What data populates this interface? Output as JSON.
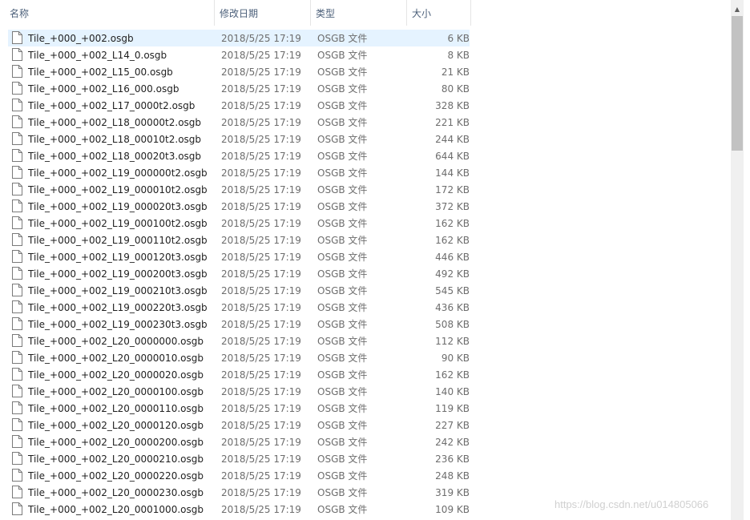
{
  "columns": {
    "name": "名称",
    "date": "修改日期",
    "type": "类型",
    "size": "大小"
  },
  "sort_indicator": "^",
  "files": [
    {
      "name": "Tile_+000_+002.osgb",
      "date": "2018/5/25 17:19",
      "type": "OSGB 文件",
      "size": "6 KB",
      "selected": true
    },
    {
      "name": "Tile_+000_+002_L14_0.osgb",
      "date": "2018/5/25 17:19",
      "type": "OSGB 文件",
      "size": "8 KB"
    },
    {
      "name": "Tile_+000_+002_L15_00.osgb",
      "date": "2018/5/25 17:19",
      "type": "OSGB 文件",
      "size": "21 KB"
    },
    {
      "name": "Tile_+000_+002_L16_000.osgb",
      "date": "2018/5/25 17:19",
      "type": "OSGB 文件",
      "size": "80 KB"
    },
    {
      "name": "Tile_+000_+002_L17_0000t2.osgb",
      "date": "2018/5/25 17:19",
      "type": "OSGB 文件",
      "size": "328 KB"
    },
    {
      "name": "Tile_+000_+002_L18_00000t2.osgb",
      "date": "2018/5/25 17:19",
      "type": "OSGB 文件",
      "size": "221 KB"
    },
    {
      "name": "Tile_+000_+002_L18_00010t2.osgb",
      "date": "2018/5/25 17:19",
      "type": "OSGB 文件",
      "size": "244 KB"
    },
    {
      "name": "Tile_+000_+002_L18_00020t3.osgb",
      "date": "2018/5/25 17:19",
      "type": "OSGB 文件",
      "size": "644 KB"
    },
    {
      "name": "Tile_+000_+002_L19_000000t2.osgb",
      "date": "2018/5/25 17:19",
      "type": "OSGB 文件",
      "size": "144 KB"
    },
    {
      "name": "Tile_+000_+002_L19_000010t2.osgb",
      "date": "2018/5/25 17:19",
      "type": "OSGB 文件",
      "size": "172 KB"
    },
    {
      "name": "Tile_+000_+002_L19_000020t3.osgb",
      "date": "2018/5/25 17:19",
      "type": "OSGB 文件",
      "size": "372 KB"
    },
    {
      "name": "Tile_+000_+002_L19_000100t2.osgb",
      "date": "2018/5/25 17:19",
      "type": "OSGB 文件",
      "size": "162 KB"
    },
    {
      "name": "Tile_+000_+002_L19_000110t2.osgb",
      "date": "2018/5/25 17:19",
      "type": "OSGB 文件",
      "size": "162 KB"
    },
    {
      "name": "Tile_+000_+002_L19_000120t3.osgb",
      "date": "2018/5/25 17:19",
      "type": "OSGB 文件",
      "size": "446 KB"
    },
    {
      "name": "Tile_+000_+002_L19_000200t3.osgb",
      "date": "2018/5/25 17:19",
      "type": "OSGB 文件",
      "size": "492 KB"
    },
    {
      "name": "Tile_+000_+002_L19_000210t3.osgb",
      "date": "2018/5/25 17:19",
      "type": "OSGB 文件",
      "size": "545 KB"
    },
    {
      "name": "Tile_+000_+002_L19_000220t3.osgb",
      "date": "2018/5/25 17:19",
      "type": "OSGB 文件",
      "size": "436 KB"
    },
    {
      "name": "Tile_+000_+002_L19_000230t3.osgb",
      "date": "2018/5/25 17:19",
      "type": "OSGB 文件",
      "size": "508 KB"
    },
    {
      "name": "Tile_+000_+002_L20_0000000.osgb",
      "date": "2018/5/25 17:19",
      "type": "OSGB 文件",
      "size": "112 KB"
    },
    {
      "name": "Tile_+000_+002_L20_0000010.osgb",
      "date": "2018/5/25 17:19",
      "type": "OSGB 文件",
      "size": "90 KB"
    },
    {
      "name": "Tile_+000_+002_L20_0000020.osgb",
      "date": "2018/5/25 17:19",
      "type": "OSGB 文件",
      "size": "162 KB"
    },
    {
      "name": "Tile_+000_+002_L20_0000100.osgb",
      "date": "2018/5/25 17:19",
      "type": "OSGB 文件",
      "size": "140 KB"
    },
    {
      "name": "Tile_+000_+002_L20_0000110.osgb",
      "date": "2018/5/25 17:19",
      "type": "OSGB 文件",
      "size": "119 KB"
    },
    {
      "name": "Tile_+000_+002_L20_0000120.osgb",
      "date": "2018/5/25 17:19",
      "type": "OSGB 文件",
      "size": "227 KB"
    },
    {
      "name": "Tile_+000_+002_L20_0000200.osgb",
      "date": "2018/5/25 17:19",
      "type": "OSGB 文件",
      "size": "242 KB"
    },
    {
      "name": "Tile_+000_+002_L20_0000210.osgb",
      "date": "2018/5/25 17:19",
      "type": "OSGB 文件",
      "size": "236 KB"
    },
    {
      "name": "Tile_+000_+002_L20_0000220.osgb",
      "date": "2018/5/25 17:19",
      "type": "OSGB 文件",
      "size": "248 KB"
    },
    {
      "name": "Tile_+000_+002_L20_0000230.osgb",
      "date": "2018/5/25 17:19",
      "type": "OSGB 文件",
      "size": "319 KB"
    },
    {
      "name": "Tile_+000_+002_L20_0001000.osgb",
      "date": "2018/5/25 17:19",
      "type": "OSGB 文件",
      "size": "109 KB"
    }
  ],
  "icons": {
    "file": "file-icon",
    "scroll_up": "chevron-up-icon"
  },
  "colors": {
    "selected_row": "#e5f3ff",
    "header_text": "#4c607a",
    "scroll_thumb": "#c2c2c2"
  },
  "watermark": "https://blog.csdn.net/u014805066"
}
